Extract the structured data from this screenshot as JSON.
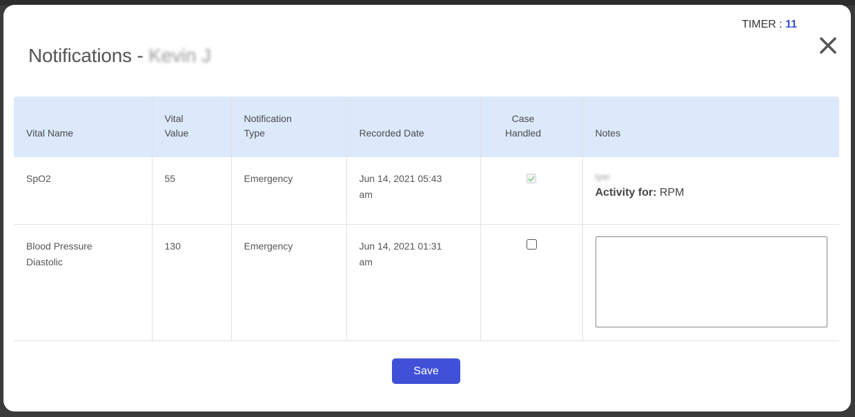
{
  "dialog": {
    "title_prefix": "Notifications -",
    "patient_name": "Kevin J",
    "timer_label": "TIMER :",
    "timer_value": "11",
    "save_label": "Save"
  },
  "table": {
    "headers": [
      [
        "Vital Name"
      ],
      [
        "Vital",
        "Value"
      ],
      [
        "Notification",
        "Type"
      ],
      [
        "Recorded Date"
      ],
      [
        "Case",
        "Handled"
      ],
      [
        "Notes"
      ]
    ],
    "rows": [
      {
        "vital_name": [
          "SpO2"
        ],
        "vital_value": "55",
        "notification_type": "Emergency",
        "recorded_date": [
          "Jun 14, 2021 05:43",
          "am"
        ],
        "case_handled": true,
        "note_text": "tyer",
        "activity_label": "Activity for:",
        "activity_value": "RPM"
      },
      {
        "vital_name": [
          "Blood Pressure",
          "Diastolic"
        ],
        "vital_value": "130",
        "notification_type": "Emergency",
        "recorded_date": [
          "Jun 14, 2021 01:31",
          "am"
        ],
        "case_handled": false,
        "note_text": ""
      }
    ]
  },
  "colors": {
    "header_bg": "#dbe9fb",
    "accent": "#4051d8",
    "timer_value": "#3b4fd6",
    "check_green": "#7bc98a"
  }
}
